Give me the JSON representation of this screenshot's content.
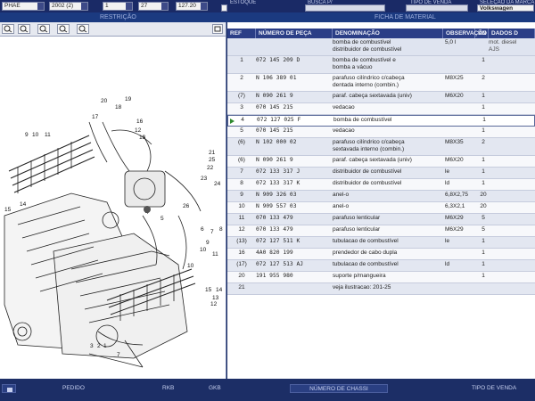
{
  "topbar": {
    "field1_value": "PHAE",
    "field2_value": "2002 (2)",
    "field3_value": "1",
    "field4_value": "27",
    "field5_value": "127.20",
    "label_estoque": "ESTOQUE",
    "label_busca": "BUSCA P/",
    "label_tipo_venda": "TIPO DE VENDA",
    "label_selecao_marca": "SELEÇÃO DA MARCA",
    "marca_value": "Volkswagen"
  },
  "subbar": {
    "restricao": "RESTRIÇÃO",
    "ficha": "FICHA DE MATERIAL"
  },
  "table": {
    "headers": {
      "ref": "REF",
      "numero": "NÚMERO DE PEÇA",
      "denominacao": "DENOMINAÇÃO",
      "observacao": "OBSERVAÇÃO",
      "un": "UN",
      "dados": "DADOS D"
    },
    "group_header": {
      "den_line1": "bomba de combustível",
      "den_line2": "distribuidor de combustível",
      "obs": "5,0 l",
      "dados_line1": "mot. diesel",
      "dados_line2": "AJS"
    },
    "rows": [
      {
        "ref": "1",
        "num": "072 145 209 D",
        "den1": "bomba de combustível e",
        "den2": "bomba a vácuo",
        "obs": "",
        "un": "1"
      },
      {
        "ref": "2",
        "num": "N 106 389 01",
        "den1": "parafuso cilíndrico c/cabeça",
        "den2": "dentada interno (combin.)",
        "obs": "M8X25",
        "un": "2"
      },
      {
        "ref": "(7)",
        "num": "N 090 261 9",
        "den1": "paraf. cabeça sextavada (univ)",
        "den2": "",
        "obs": "M6X20",
        "un": "1"
      },
      {
        "ref": "3",
        "num": "070 145 215",
        "den1": "vedacao",
        "den2": "",
        "obs": "",
        "un": "1"
      },
      {
        "ref": "4",
        "num": "072 127 025 F",
        "den1": "bomba de combustível",
        "den2": "",
        "obs": "",
        "un": "1"
      },
      {
        "ref": "5",
        "num": "070 145 215",
        "den1": "vedacao",
        "den2": "",
        "obs": "",
        "un": "1"
      },
      {
        "ref": "(6)",
        "num": "N 102 000 02",
        "den1": "parafuso cilíndrico c/cabeça",
        "den2": "sextavada interno (combin.)",
        "obs": "M8X35",
        "un": "2"
      },
      {
        "ref": "(6)",
        "num": "N 090 261 9",
        "den1": "paraf. cabeça sextavada (univ)",
        "den2": "",
        "obs": "M6X20",
        "un": "1"
      },
      {
        "ref": "7",
        "num": "072 133 317 J",
        "den1": "distribuidor de combustível",
        "den2": "",
        "obs": "le",
        "un": "1"
      },
      {
        "ref": "8",
        "num": "072 133 317 K",
        "den1": "distribuidor de combustível",
        "den2": "",
        "obs": "ld",
        "un": "1"
      },
      {
        "ref": "9",
        "num": "N 909 326 03",
        "den1": "anel-o",
        "den2": "",
        "obs": "6,8X2,75",
        "un": "20"
      },
      {
        "ref": "10",
        "num": "N 909 557 03",
        "den1": "anel-o",
        "den2": "",
        "obs": "6,3X2,1",
        "un": "20"
      },
      {
        "ref": "11",
        "num": "070 133 479",
        "den1": "parafuso lenticular",
        "den2": "",
        "obs": "M6X29",
        "un": "5"
      },
      {
        "ref": "12",
        "num": "070 133 479",
        "den1": "parafuso lenticular",
        "den2": "",
        "obs": "M6X29",
        "un": "5"
      },
      {
        "ref": "(13)",
        "num": "072 127 511 K",
        "den1": "tubulacao de combustível",
        "den2": "",
        "obs": "le",
        "un": "1"
      },
      {
        "ref": "16",
        "num": "4A0 820 199",
        "den1": "prendedor de cabo dupla",
        "den2": "",
        "obs": "",
        "un": "1"
      },
      {
        "ref": "(17)",
        "num": "072 127 513 AJ",
        "den1": "tubulacao de combustível",
        "den2": "",
        "obs": "ld",
        "un": "1"
      },
      {
        "ref": "20",
        "num": "191 955 980",
        "den1": "suporte p/mangueira",
        "den2": "",
        "obs": "",
        "un": "1"
      },
      {
        "ref": "21",
        "num": "",
        "den1": "veja ilustracao: 201-25",
        "den2": "",
        "obs": "",
        "un": ""
      }
    ]
  },
  "diagram": {
    "labels": [
      "20",
      "18",
      "17",
      "19",
      "16",
      "12",
      "13",
      "9",
      "10",
      "11",
      "15",
      "14",
      "21",
      "25",
      "22",
      "23",
      "24",
      "26",
      "4",
      "5",
      "6",
      "7",
      "8",
      "9",
      "10",
      "11",
      "10",
      "15",
      "14",
      "13",
      "12",
      "3",
      "2",
      "1",
      "7"
    ]
  },
  "bottombar": {
    "pedido": "PEDIDO",
    "rkb": "RKB",
    "gkb": "GKB",
    "numero_chassi": "NÚMERO DE CHASSI",
    "tipo_venda": "TIPO DE VENDA"
  },
  "colors": {
    "header_bg": "#2b3e86",
    "selected_arrow": "#2f8a2f"
  }
}
